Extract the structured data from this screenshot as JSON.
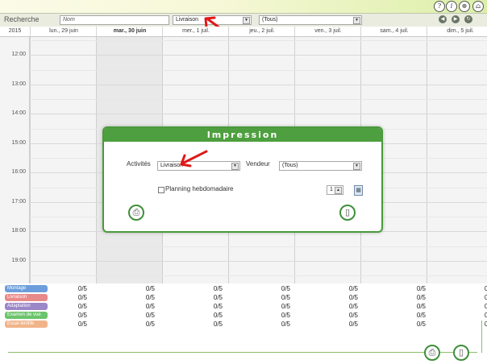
{
  "top_icons": [
    "help-icon",
    "info-icon",
    "zoom-icon",
    "home-icon"
  ],
  "icon_glyphs": {
    "help": "?",
    "info": "i",
    "zoom": "⊕",
    "home": "⌂"
  },
  "search": {
    "label": "Recherche",
    "name_placeholder": "Nom",
    "activity_value": "Livraison",
    "seller_value": "(Tous)"
  },
  "nav_glyphs": {
    "prev": "◀",
    "next": "▶",
    "refresh": "↻"
  },
  "calendar": {
    "year": "2015",
    "days": [
      {
        "label": "lun., 29 juin",
        "today": false
      },
      {
        "label": "mar., 30 juin",
        "today": true
      },
      {
        "label": "mer., 1 juil.",
        "today": false
      },
      {
        "label": "jeu., 2 juil.",
        "today": false
      },
      {
        "label": "ven., 3 juil.",
        "today": false
      },
      {
        "label": "sam., 4 juil.",
        "today": false
      },
      {
        "label": "dim., 5 juil.",
        "today": false
      }
    ],
    "hours": [
      "12:00",
      "13:00",
      "14:00",
      "15:00",
      "16:00",
      "17:00",
      "18:00",
      "19:00"
    ]
  },
  "activities": [
    {
      "label": "Montage",
      "color": "#6d9edb",
      "counts": [
        "0/5",
        "0/5",
        "0/5",
        "0/5",
        "0/5",
        "0/5",
        "0/5"
      ]
    },
    {
      "label": "Livraison",
      "color": "#e98a8a",
      "counts": [
        "0/5",
        "0/5",
        "0/5",
        "0/5",
        "0/5",
        "0/5",
        "0/5"
      ]
    },
    {
      "label": "Adaptation",
      "color": "#9b86c8",
      "counts": [
        "0/5",
        "0/5",
        "0/5",
        "0/5",
        "0/5",
        "0/5",
        "0/5"
      ]
    },
    {
      "label": "Examen de vue",
      "color": "#6cc46c",
      "counts": [
        "0/5",
        "0/5",
        "0/5",
        "0/5",
        "0/5",
        "0/5",
        "0/5"
      ]
    },
    {
      "label": "Essai lentille",
      "color": "#f1b48a",
      "counts": [
        "0/5",
        "0/5",
        "0/5",
        "0/5",
        "0/5",
        "0/5",
        "0/5"
      ]
    }
  ],
  "modal": {
    "title": "Impression",
    "activities_label": "Activités",
    "activities_value": "Livraison",
    "seller_label": "Vendeur",
    "seller_value": "(Tous)",
    "weekly_label": "Planning hebdomadaire",
    "weekly_checked": false,
    "copies_value": "1"
  },
  "colors": {
    "accent_green": "#4e9f3f",
    "annotation_red": "#e01818"
  }
}
